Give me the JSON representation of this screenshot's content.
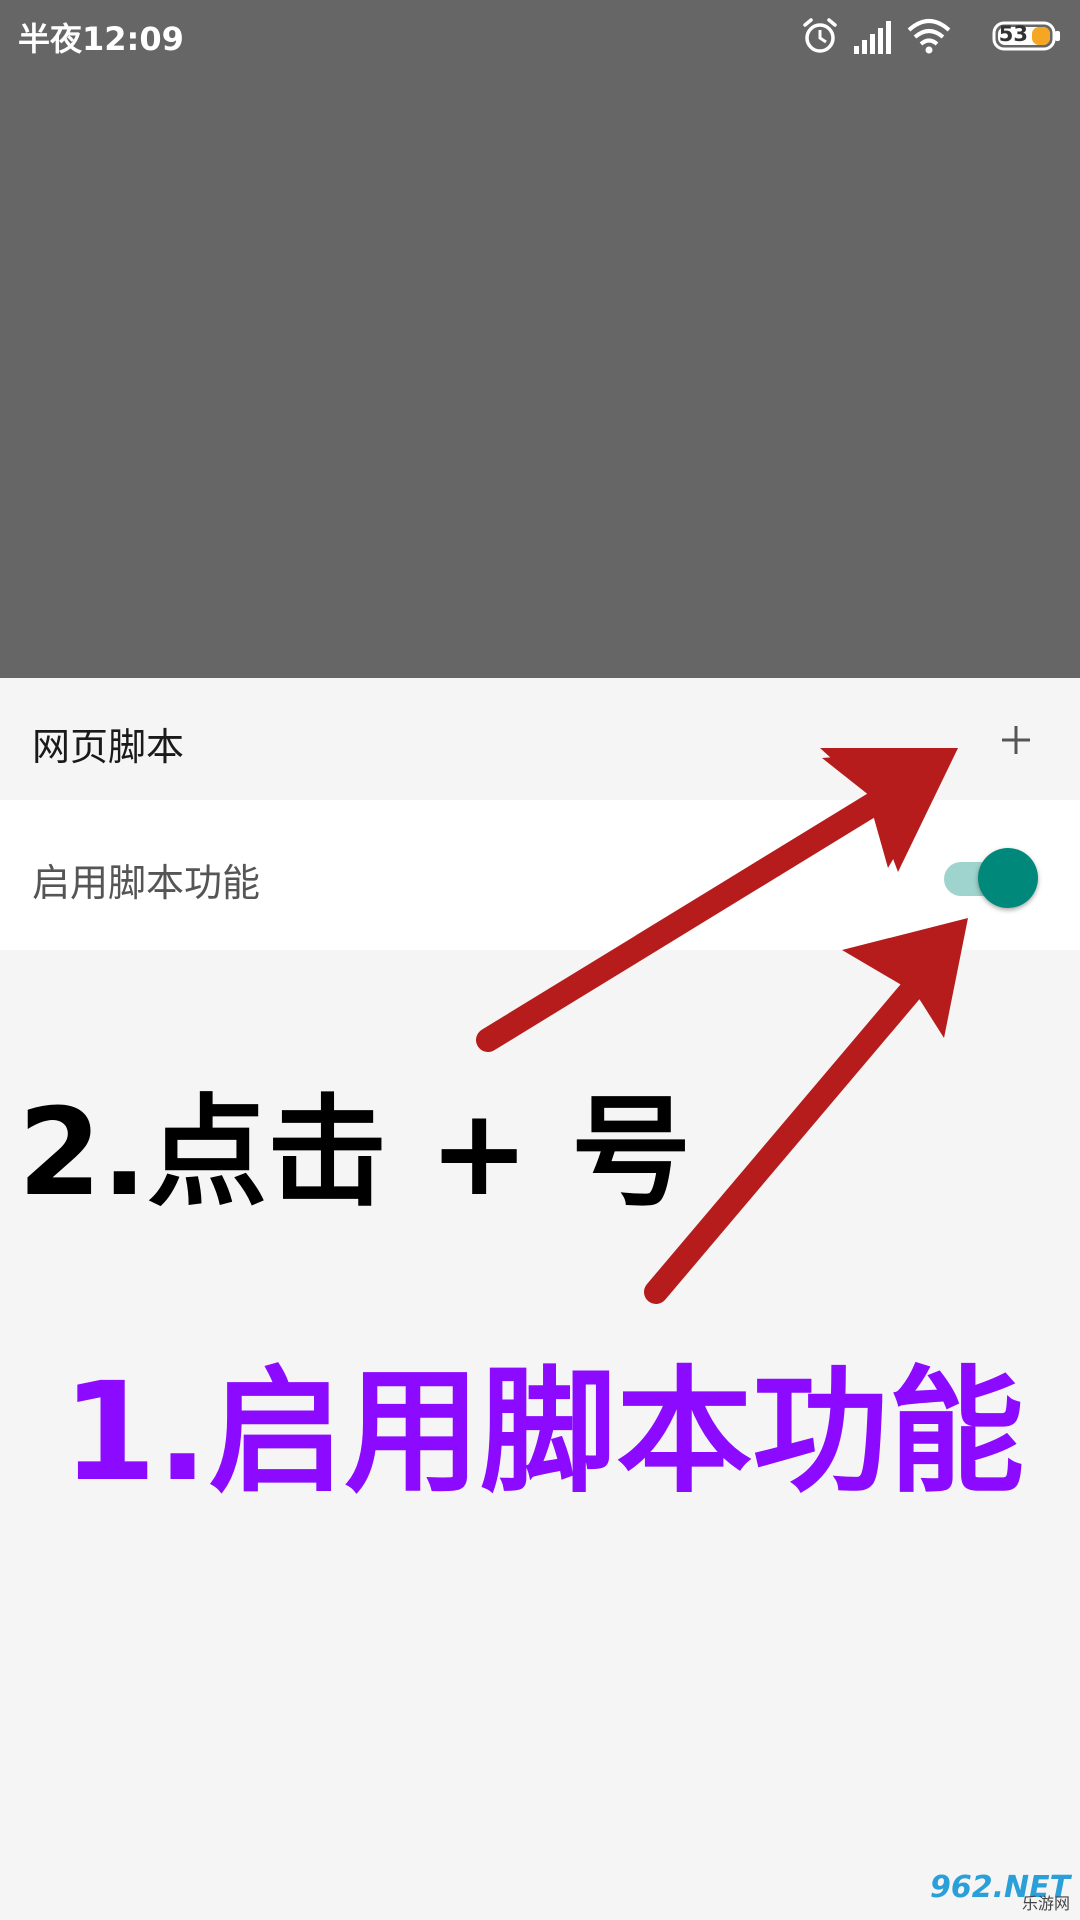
{
  "status_bar": {
    "time": "半夜12:09",
    "battery": "53",
    "icons": [
      "alarm-icon",
      "signal-icon",
      "wifi-icon",
      "battery-icon"
    ]
  },
  "section": {
    "title": "网页脚本",
    "add_icon": "plus-icon"
  },
  "settings": [
    {
      "label": "启用脚本功能",
      "enabled": true
    }
  ],
  "annotations": {
    "step2": "2.点击 + 号",
    "step1": "1.启用脚本功能",
    "arrow_color": "#b71c1c",
    "step1_color": "#8b0aff"
  },
  "watermark": {
    "main": "962.NET",
    "sub": "乐游网"
  },
  "colors": {
    "dim_overlay": "#666666",
    "toggle_thumb": "#00897b",
    "toggle_track": "#9fd3cd"
  }
}
